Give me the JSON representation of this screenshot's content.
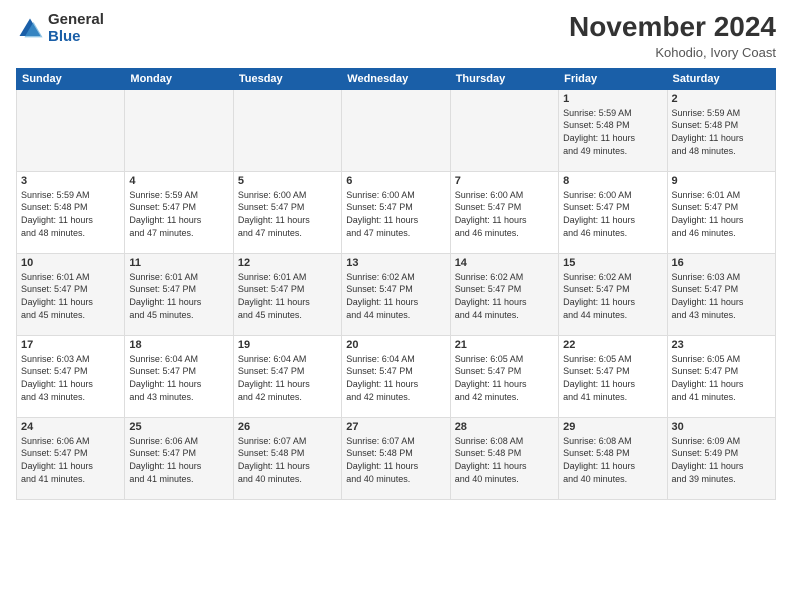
{
  "logo": {
    "general": "General",
    "blue": "Blue"
  },
  "title": "November 2024",
  "location": "Kohodio, Ivory Coast",
  "days_of_week": [
    "Sunday",
    "Monday",
    "Tuesday",
    "Wednesday",
    "Thursday",
    "Friday",
    "Saturday"
  ],
  "weeks": [
    [
      {
        "day": "",
        "info": ""
      },
      {
        "day": "",
        "info": ""
      },
      {
        "day": "",
        "info": ""
      },
      {
        "day": "",
        "info": ""
      },
      {
        "day": "",
        "info": ""
      },
      {
        "day": "1",
        "info": "Sunrise: 5:59 AM\nSunset: 5:48 PM\nDaylight: 11 hours\nand 49 minutes."
      },
      {
        "day": "2",
        "info": "Sunrise: 5:59 AM\nSunset: 5:48 PM\nDaylight: 11 hours\nand 48 minutes."
      }
    ],
    [
      {
        "day": "3",
        "info": "Sunrise: 5:59 AM\nSunset: 5:48 PM\nDaylight: 11 hours\nand 48 minutes."
      },
      {
        "day": "4",
        "info": "Sunrise: 5:59 AM\nSunset: 5:47 PM\nDaylight: 11 hours\nand 47 minutes."
      },
      {
        "day": "5",
        "info": "Sunrise: 6:00 AM\nSunset: 5:47 PM\nDaylight: 11 hours\nand 47 minutes."
      },
      {
        "day": "6",
        "info": "Sunrise: 6:00 AM\nSunset: 5:47 PM\nDaylight: 11 hours\nand 47 minutes."
      },
      {
        "day": "7",
        "info": "Sunrise: 6:00 AM\nSunset: 5:47 PM\nDaylight: 11 hours\nand 46 minutes."
      },
      {
        "day": "8",
        "info": "Sunrise: 6:00 AM\nSunset: 5:47 PM\nDaylight: 11 hours\nand 46 minutes."
      },
      {
        "day": "9",
        "info": "Sunrise: 6:01 AM\nSunset: 5:47 PM\nDaylight: 11 hours\nand 46 minutes."
      }
    ],
    [
      {
        "day": "10",
        "info": "Sunrise: 6:01 AM\nSunset: 5:47 PM\nDaylight: 11 hours\nand 45 minutes."
      },
      {
        "day": "11",
        "info": "Sunrise: 6:01 AM\nSunset: 5:47 PM\nDaylight: 11 hours\nand 45 minutes."
      },
      {
        "day": "12",
        "info": "Sunrise: 6:01 AM\nSunset: 5:47 PM\nDaylight: 11 hours\nand 45 minutes."
      },
      {
        "day": "13",
        "info": "Sunrise: 6:02 AM\nSunset: 5:47 PM\nDaylight: 11 hours\nand 44 minutes."
      },
      {
        "day": "14",
        "info": "Sunrise: 6:02 AM\nSunset: 5:47 PM\nDaylight: 11 hours\nand 44 minutes."
      },
      {
        "day": "15",
        "info": "Sunrise: 6:02 AM\nSunset: 5:47 PM\nDaylight: 11 hours\nand 44 minutes."
      },
      {
        "day": "16",
        "info": "Sunrise: 6:03 AM\nSunset: 5:47 PM\nDaylight: 11 hours\nand 43 minutes."
      }
    ],
    [
      {
        "day": "17",
        "info": "Sunrise: 6:03 AM\nSunset: 5:47 PM\nDaylight: 11 hours\nand 43 minutes."
      },
      {
        "day": "18",
        "info": "Sunrise: 6:04 AM\nSunset: 5:47 PM\nDaylight: 11 hours\nand 43 minutes."
      },
      {
        "day": "19",
        "info": "Sunrise: 6:04 AM\nSunset: 5:47 PM\nDaylight: 11 hours\nand 42 minutes."
      },
      {
        "day": "20",
        "info": "Sunrise: 6:04 AM\nSunset: 5:47 PM\nDaylight: 11 hours\nand 42 minutes."
      },
      {
        "day": "21",
        "info": "Sunrise: 6:05 AM\nSunset: 5:47 PM\nDaylight: 11 hours\nand 42 minutes."
      },
      {
        "day": "22",
        "info": "Sunrise: 6:05 AM\nSunset: 5:47 PM\nDaylight: 11 hours\nand 41 minutes."
      },
      {
        "day": "23",
        "info": "Sunrise: 6:05 AM\nSunset: 5:47 PM\nDaylight: 11 hours\nand 41 minutes."
      }
    ],
    [
      {
        "day": "24",
        "info": "Sunrise: 6:06 AM\nSunset: 5:47 PM\nDaylight: 11 hours\nand 41 minutes."
      },
      {
        "day": "25",
        "info": "Sunrise: 6:06 AM\nSunset: 5:47 PM\nDaylight: 11 hours\nand 41 minutes."
      },
      {
        "day": "26",
        "info": "Sunrise: 6:07 AM\nSunset: 5:48 PM\nDaylight: 11 hours\nand 40 minutes."
      },
      {
        "day": "27",
        "info": "Sunrise: 6:07 AM\nSunset: 5:48 PM\nDaylight: 11 hours\nand 40 minutes."
      },
      {
        "day": "28",
        "info": "Sunrise: 6:08 AM\nSunset: 5:48 PM\nDaylight: 11 hours\nand 40 minutes."
      },
      {
        "day": "29",
        "info": "Sunrise: 6:08 AM\nSunset: 5:48 PM\nDaylight: 11 hours\nand 40 minutes."
      },
      {
        "day": "30",
        "info": "Sunrise: 6:09 AM\nSunset: 5:49 PM\nDaylight: 11 hours\nand 39 minutes."
      }
    ]
  ]
}
